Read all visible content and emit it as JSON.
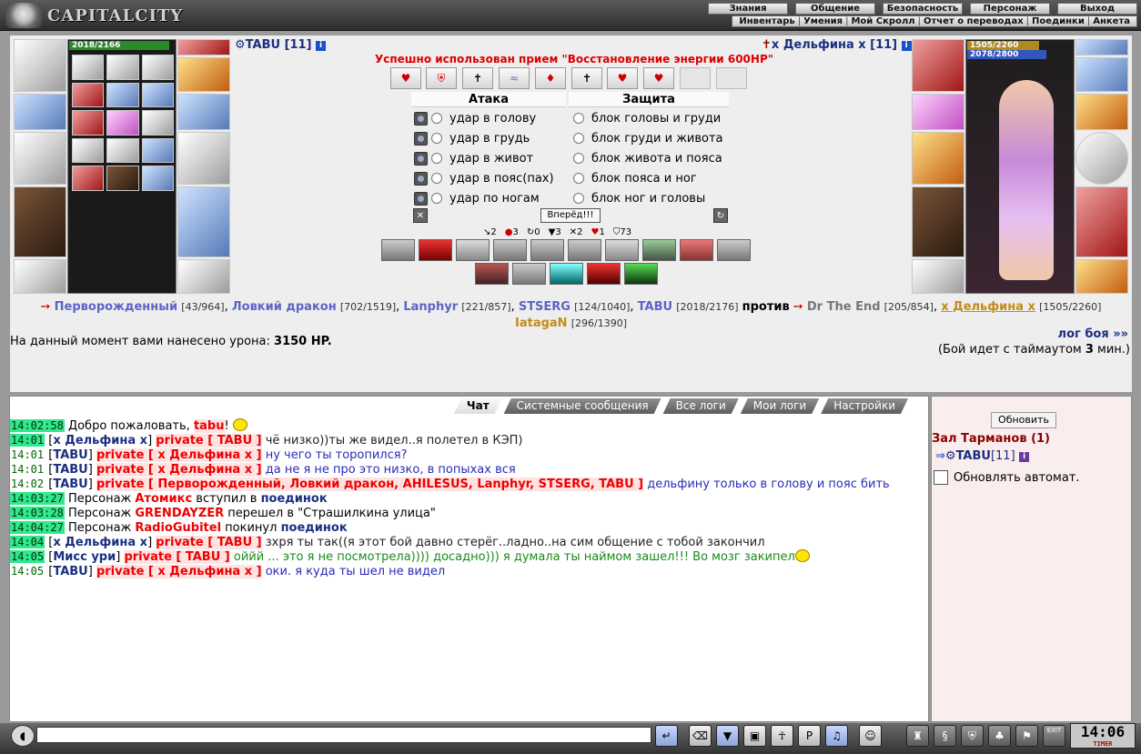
{
  "header": {
    "logo_text": "CAPITALCITY",
    "menu_main": [
      "Знания",
      "Общение",
      "Безопасность",
      "Персонаж",
      "Выход"
    ],
    "menu_sub": [
      "Инвентарь",
      "Умения",
      "Мой Скролл",
      "Отчет о переводах",
      "Поединки",
      "Анкета"
    ]
  },
  "battle": {
    "player": {
      "name": "TABU [11]",
      "hp_text": "2018/2166",
      "hp_fraction": 0.93
    },
    "enemy": {
      "name": "x Дельфина x [11]",
      "hp_text": "1505/2260",
      "mana_text": "2078/2800",
      "hp_fraction": 0.67,
      "mana_fraction": 0.74
    },
    "used_message": "Успешно использован прием \"Восстановление энергии 600HP\"",
    "attack_title": "Атака",
    "defense_title": "Защита",
    "attacks": [
      "удар в голову",
      "удар в грудь",
      "удар в живот",
      "удар в пояс(пах)",
      "удар по ногам"
    ],
    "defenses": [
      "блок головы и груди",
      "блок груди и живота",
      "блок живота и пояса",
      "блок пояса и ног",
      "блок ног и головы"
    ],
    "forward_label": "Вперёд!!!",
    "stats": [
      {
        "icon": "sword-icon",
        "value": "2"
      },
      {
        "icon": "blood-icon",
        "value": "3"
      },
      {
        "icon": "dodge-icon",
        "value": "0"
      },
      {
        "icon": "shield-icon",
        "value": "3"
      },
      {
        "icon": "cross-icon",
        "value": "2"
      },
      {
        "icon": "heart-icon",
        "value": "1"
      },
      {
        "icon": "armor-icon",
        "value": "73"
      }
    ],
    "team_left": [
      {
        "name": "Перворожденный",
        "hp": "[43/964]"
      },
      {
        "name": "Ловкий дракон",
        "hp": "[702/1519]"
      },
      {
        "name": "Lanphyr",
        "hp": "[221/857]"
      },
      {
        "name": "STSERG",
        "hp": "[124/1040]"
      },
      {
        "name": "TABU",
        "hp": "[2018/2176]"
      }
    ],
    "vs_label": "против",
    "team_right": [
      {
        "name": "Dr The End",
        "hp": "[205/854]"
      },
      {
        "name": "x Дельфина x",
        "hp": "[1505/2260]"
      },
      {
        "name": "IatagaN",
        "hp": "[296/1390]"
      }
    ],
    "damage_prefix": "На данный момент вами нанесено урона: ",
    "damage_value": "3150 HP.",
    "log_link": "лог боя »»",
    "timeout_text_a": "(Бой идет с таймаутом ",
    "timeout_value": "3",
    "timeout_text_b": " мин.)"
  },
  "chat": {
    "tabs": [
      "Чат",
      "Системные сообщения",
      "Все логи",
      "Мои логи",
      "Настройки"
    ],
    "messages": [
      {
        "time": "14:02:58",
        "hl": true,
        "pre": "Добро пожаловать, ",
        "nick": "tabu",
        "tag": "",
        "text": "!",
        "cls": "sys",
        "smile": true
      },
      {
        "time": "14:01",
        "hl": true,
        "pre": "",
        "nick": "x Дельфина x",
        "tag": "private [ TABU ]",
        "text": " чё низко))ты же видел..я полетел в КЭП)",
        "cls": "sys-dark"
      },
      {
        "time": "14:01",
        "hl": false,
        "pre": "",
        "nick": "TABU",
        "tag": "private [ x Дельфина x ]",
        "text": " ну чего ты торопился?",
        "cls": "txt-blue"
      },
      {
        "time": "14:01",
        "hl": false,
        "pre": "",
        "nick": "TABU",
        "tag": "private [ x Дельфина x ]",
        "text": " да не я не про это низко, в попыхах вся",
        "cls": "txt-blue"
      },
      {
        "time": "14:02",
        "hl": false,
        "pre": "",
        "nick": "TABU",
        "tag": "private [ Перворожденный, Ловкий дракон, AHILESUS, Lanphyr, STSERG, TABU ]",
        "text": " дельфину только в голову и пояс бить",
        "cls": "txt-blue"
      },
      {
        "time": "14:03:27",
        "hl": true,
        "pre": "Персонаж ",
        "red": "Атомикс",
        "mid": " вступил в ",
        "blue": "поединок",
        "sys": true
      },
      {
        "time": "14:03:28",
        "hl": true,
        "pre": "Персонаж ",
        "red": "GRENDAYZER",
        "mid": " перешел в \"Страшилкина улица\"",
        "blue": "",
        "sys": true
      },
      {
        "time": "14:04:27",
        "hl": true,
        "pre": "Персонаж ",
        "red": "RadioGubitel",
        "mid": " покинул ",
        "blue": "поединок",
        "sys": true
      },
      {
        "time": "14:04",
        "hl": true,
        "pre": "",
        "nick": "x Дельфина x",
        "tag": "private [ TABU ]",
        "text": " зхря ты так((я этот бой давно стерёг..ладно..на сим общение с тобой закончил",
        "cls": "sys-dark"
      },
      {
        "time": "14:05",
        "hl": true,
        "pre": "",
        "nick": "Мисс ури",
        "tag": "private [ TABU ]",
        "text": " оййй ... это я не посмотрела)))) досадно))) я думала ты наймом зашел!!! Во мозг закипел",
        "cls": "txt-green",
        "smile": true
      },
      {
        "time": "14:05",
        "hl": false,
        "pre": "",
        "nick": "TABU",
        "tag": "private [ x Дельфина x ]",
        "text": " оки. я куда ты шел не видел",
        "cls": "txt-blue"
      }
    ]
  },
  "side": {
    "refresh_label": "Обновить",
    "room_title": "Зал Тарманов (1)",
    "user": "TABU",
    "user_level": "[11]",
    "auto_label": "Обновлять автомат."
  },
  "bottom": {
    "clock": "14:06",
    "clock_sub": "TIMER",
    "exit_label": "EXIT"
  },
  "colors": {
    "accent": "#1a2f80",
    "private": "#ee0000",
    "time_hl": "#31e890"
  }
}
